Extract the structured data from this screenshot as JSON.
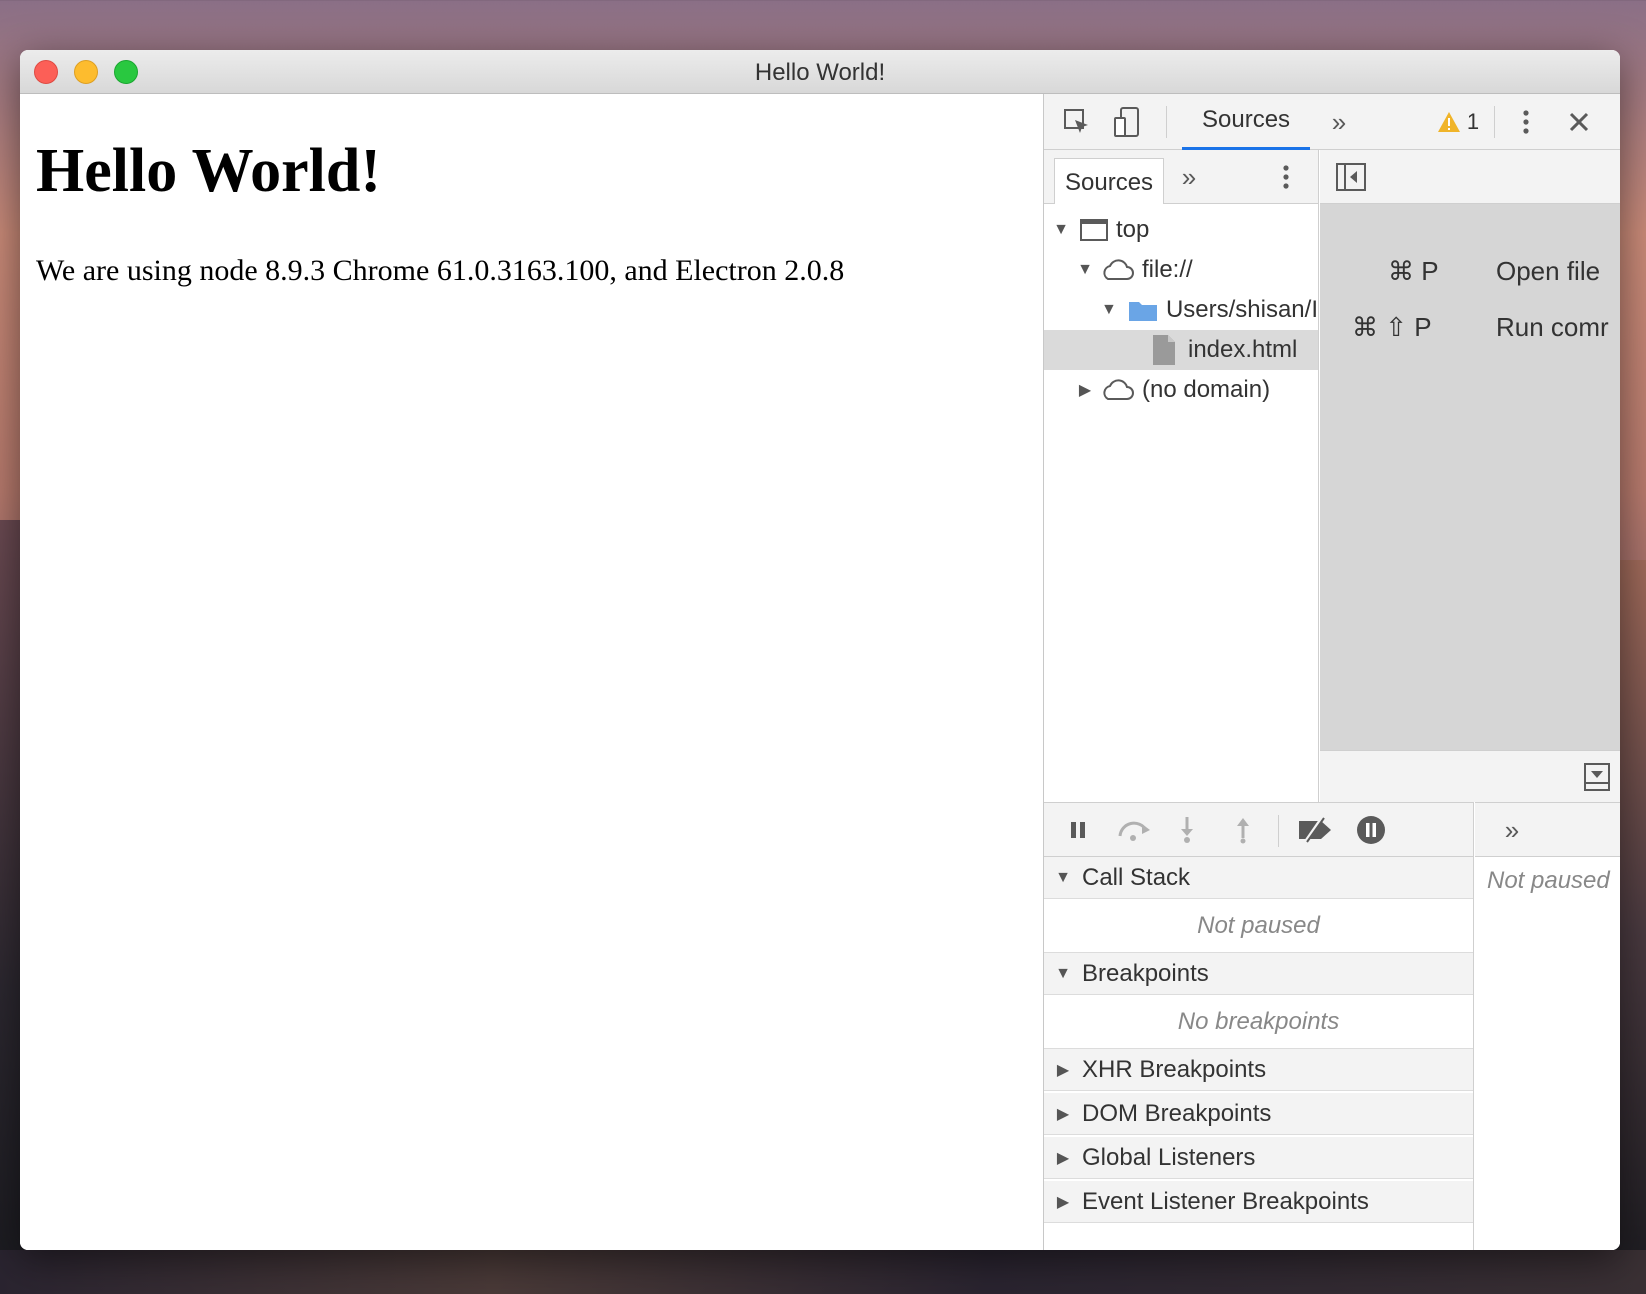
{
  "window": {
    "title": "Hello World!"
  },
  "page": {
    "heading": "Hello World!",
    "paragraph": "We are using node 8.9.3 Chrome 61.0.3163.100, and Electron 2.0.8"
  },
  "devtools": {
    "main_tab": "Sources",
    "more_tabs_icon": "»",
    "warning_count": "1",
    "navigator": {
      "tab": "Sources",
      "more_icon": "»",
      "tree": [
        {
          "label": "top",
          "icon": "frame-icon",
          "expanded": true
        },
        {
          "label": "file://",
          "icon": "cloud-icon",
          "expanded": true
        },
        {
          "label": "Users/shisan/I",
          "icon": "folder-icon",
          "expanded": true
        },
        {
          "label": "index.html",
          "icon": "file-icon",
          "selected": true
        },
        {
          "label": "(no domain)",
          "icon": "cloud-icon",
          "expanded": false
        }
      ]
    },
    "editor": {
      "shortcuts": [
        {
          "keys": "⌘ P",
          "action": "Open file"
        },
        {
          "keys": "⌘ ⇧ P",
          "action": "Run comr"
        }
      ]
    },
    "debugger": {
      "sections": [
        {
          "title": "Call Stack",
          "expanded": true,
          "body": "Not paused"
        },
        {
          "title": "Breakpoints",
          "expanded": true,
          "body": "No breakpoints"
        },
        {
          "title": "XHR Breakpoints",
          "expanded": false
        },
        {
          "title": "DOM Breakpoints",
          "expanded": false
        },
        {
          "title": "Global Listeners",
          "expanded": false
        },
        {
          "title": "Event Listener Breakpoints",
          "expanded": false
        }
      ]
    },
    "scope": {
      "more_icon": "»",
      "status": "Not paused"
    }
  },
  "colors": {
    "accent": "#1a73e8",
    "folder": "#6aa5e6",
    "warning": "#f0b429"
  }
}
